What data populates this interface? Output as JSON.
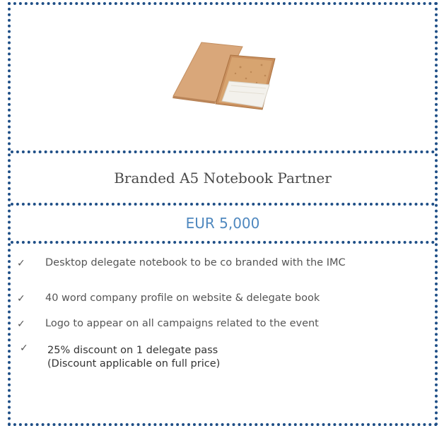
{
  "card": {
    "title": "Branded A5 Notebook Partner",
    "price": "EUR 5,000",
    "image_alt": "notebook-product-image"
  },
  "features": [
    {
      "text": "Desktop delegate notebook to be co branded with the IMC",
      "sub": ""
    },
    {
      "text": "40 word company profile on website & delegate book",
      "sub": ""
    },
    {
      "text": "Logo to appear on all campaigns related to the event",
      "sub": ""
    },
    {
      "text": "25% discount on 1 delegate pass",
      "sub": "(Discount applicable on full price)"
    }
  ],
  "check_icon": "✓",
  "colors": {
    "border": "#1f4f87",
    "price": "#4f88bf",
    "title": "#4a4a4a",
    "body_text": "#555555"
  }
}
